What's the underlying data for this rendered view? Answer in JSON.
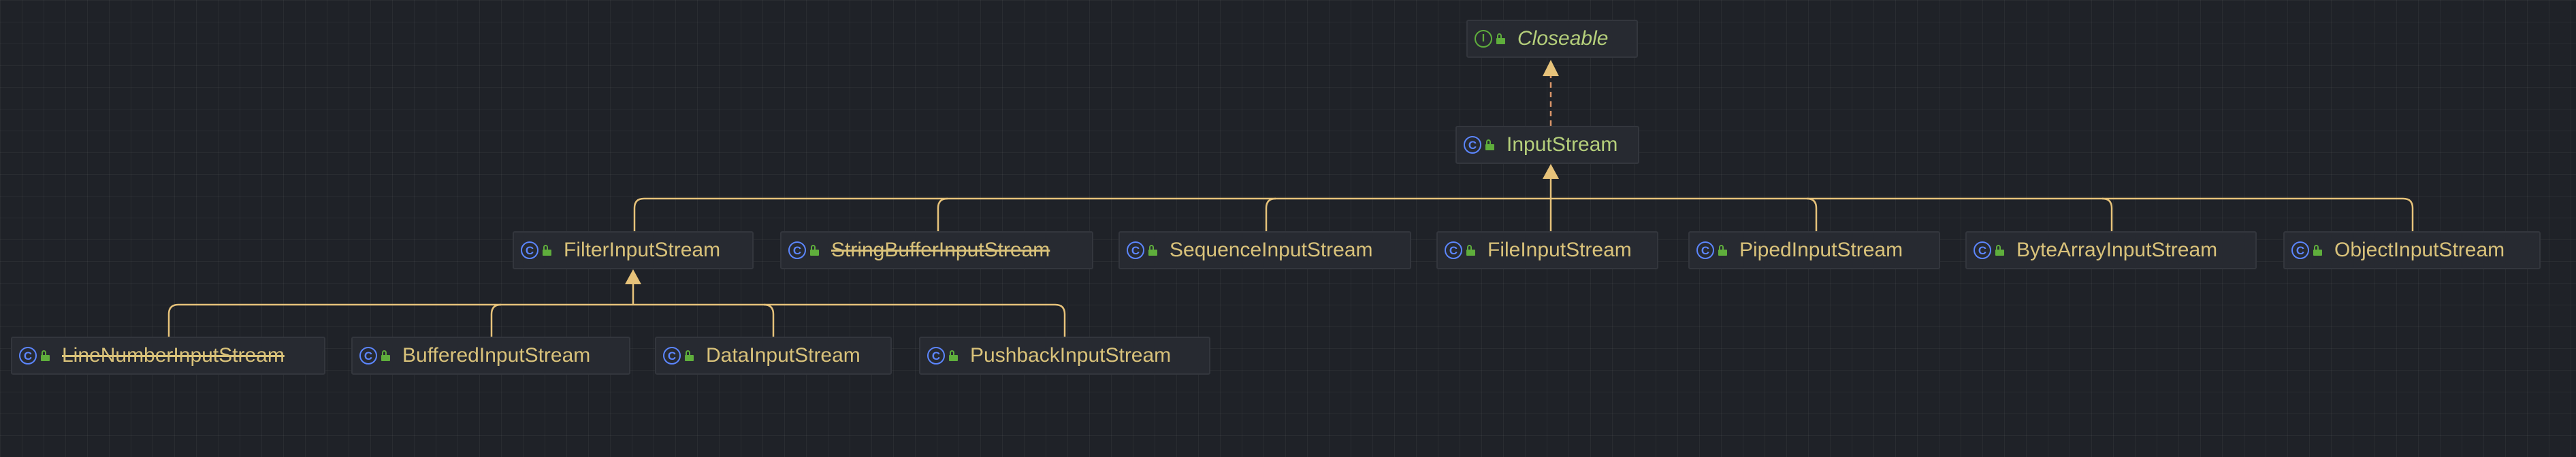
{
  "diagram": {
    "type": "class-hierarchy",
    "colors": {
      "background": "#1f2228",
      "node_bg": "#272a31",
      "class_icon": "#5c86ff",
      "interface_icon": "#5fae3c",
      "access_icon": "#5fae3c",
      "class_label": "#d9c27a",
      "highlight_label": "#b5cf7b",
      "edge": "#e6c27a",
      "implements_edge": "#d9956a"
    },
    "nodes": [
      {
        "id": "closeable",
        "label": "Closeable",
        "kind": "interface",
        "icon": "interface-icon",
        "style": "italic"
      },
      {
        "id": "inputstream",
        "label": "InputStream",
        "kind": "class",
        "icon": "class-icon",
        "style": "highlight"
      },
      {
        "id": "filter",
        "label": "FilterInputStream",
        "kind": "class",
        "icon": "class-icon"
      },
      {
        "id": "stringbuffer",
        "label": "StringBufferInputStream",
        "kind": "class",
        "icon": "class-icon",
        "deprecated": true
      },
      {
        "id": "sequence",
        "label": "SequenceInputStream",
        "kind": "class",
        "icon": "class-icon"
      },
      {
        "id": "file",
        "label": "FileInputStream",
        "kind": "class",
        "icon": "class-icon"
      },
      {
        "id": "piped",
        "label": "PipedInputStream",
        "kind": "class",
        "icon": "class-icon"
      },
      {
        "id": "bytearray",
        "label": "ByteArrayInputStream",
        "kind": "class",
        "icon": "class-icon"
      },
      {
        "id": "object",
        "label": "ObjectInputStream",
        "kind": "class",
        "icon": "class-icon"
      },
      {
        "id": "linenumber",
        "label": "LineNumberInputStream",
        "kind": "class",
        "icon": "class-icon",
        "deprecated": true
      },
      {
        "id": "buffered",
        "label": "BufferedInputStream",
        "kind": "class",
        "icon": "class-icon"
      },
      {
        "id": "data",
        "label": "DataInputStream",
        "kind": "class",
        "icon": "class-icon"
      },
      {
        "id": "pushback",
        "label": "PushbackInputStream",
        "kind": "class",
        "icon": "class-icon"
      }
    ],
    "edges": [
      {
        "from": "inputstream",
        "to": "closeable",
        "type": "implements"
      },
      {
        "from": "filter",
        "to": "inputstream",
        "type": "extends"
      },
      {
        "from": "stringbuffer",
        "to": "inputstream",
        "type": "extends"
      },
      {
        "from": "sequence",
        "to": "inputstream",
        "type": "extends"
      },
      {
        "from": "file",
        "to": "inputstream",
        "type": "extends"
      },
      {
        "from": "piped",
        "to": "inputstream",
        "type": "extends"
      },
      {
        "from": "bytearray",
        "to": "inputstream",
        "type": "extends"
      },
      {
        "from": "object",
        "to": "inputstream",
        "type": "extends"
      },
      {
        "from": "linenumber",
        "to": "filter",
        "type": "extends"
      },
      {
        "from": "buffered",
        "to": "filter",
        "type": "extends"
      },
      {
        "from": "data",
        "to": "filter",
        "type": "extends"
      },
      {
        "from": "pushback",
        "to": "filter",
        "type": "extends"
      }
    ]
  }
}
